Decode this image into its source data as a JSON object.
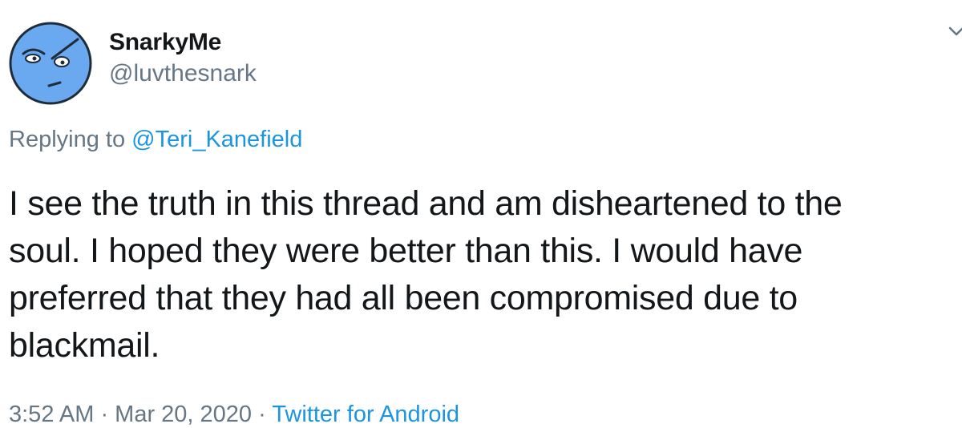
{
  "user": {
    "display_name": "SnarkyMe",
    "handle": "@luvthesnark",
    "avatar_icon": "angry-face-avatar-icon",
    "avatar_color": "#6aa8f0"
  },
  "reply": {
    "prefix": "Replying to ",
    "mention": "@Teri_Kanefield"
  },
  "tweet": {
    "lines": [
      "I see the truth in this thread and am disheartened to the",
      "soul. I hoped they were better than this. I would have",
      "preferred that they had all been compromised due to",
      "blackmail."
    ]
  },
  "meta": {
    "timestamp": "3:52 AM · Mar 20, 2020 · ",
    "source": "Twitter for Android"
  },
  "colors": {
    "text": "#14171a",
    "secondary": "#657786",
    "link": "#1b95e0"
  }
}
